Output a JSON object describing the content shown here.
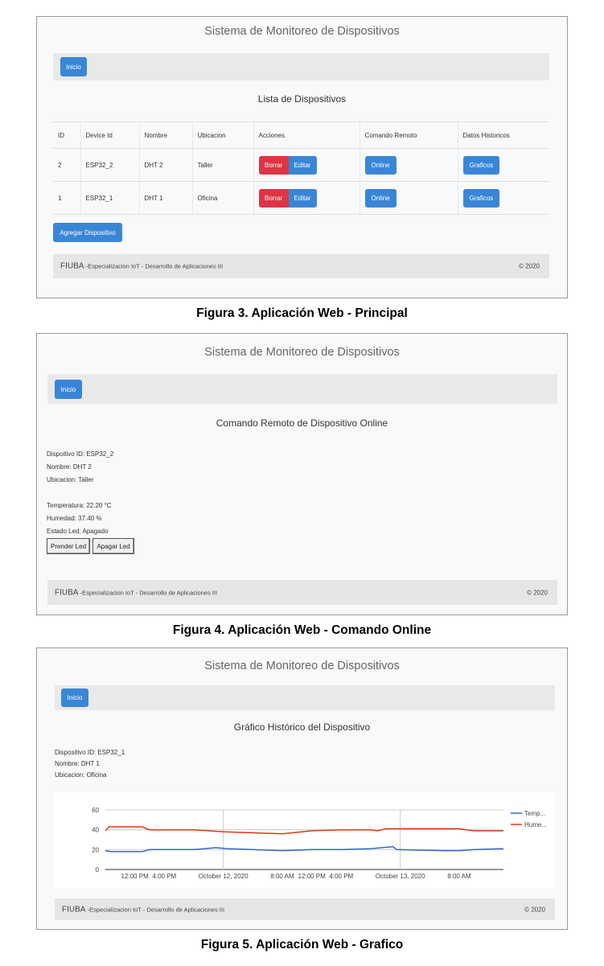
{
  "app_title": "Sistema de Monitoreo de Dispositivos",
  "nav": {
    "home_label": "Inicio"
  },
  "footer": {
    "brand": "FIUBA",
    "text": "-Especializacion IoT - Desarrollo de Aplicaciones III",
    "copyright": "© 2020"
  },
  "figure3": {
    "caption": "Figura 3. Aplicación Web - Principal",
    "subtitle": "Lista de Dispositivos",
    "columns": [
      "ID",
      "Device Id",
      "Nombre",
      "Ubicacion",
      "Acciones",
      "Comando Remoto",
      "Datos Historicos"
    ],
    "rows": [
      {
        "id": "2",
        "device_id": "ESP32_2",
        "nombre": "DHT 2",
        "ubicacion": "Taller"
      },
      {
        "id": "1",
        "device_id": "ESP32_1",
        "nombre": "DHT 1",
        "ubicacion": "Oficina"
      }
    ],
    "delete_label": "Borrar",
    "edit_label": "Editar",
    "online_label": "Online",
    "charts_label": "Graficos",
    "add_label": "Agregar Dispositivo"
  },
  "figure4": {
    "caption": "Figura 4. Aplicación Web - Comando Online",
    "subtitle": "Comando Remoto de Dispositivo Online",
    "device_line": "Dispoitivo ID: ESP32_2",
    "name_line": "Nombre: DHT 2",
    "location_line": "Ubicacion: Taller",
    "temp_line": "Temperatura: 22.20 °C",
    "humidity_line": "Humedad: 37.40 %",
    "led_line": "Estado Led: Apagado",
    "led_on_label": "Prender Led",
    "led_off_label": "Apagar Led"
  },
  "figure5": {
    "caption": "Figura 5. Aplicación Web - Grafico",
    "subtitle": "Gráfico Histórico del Dispositivo",
    "device_line": "Dispositivo ID: ESP32_1",
    "name_line": "Nombre: DHT 1",
    "location_line": "Ubicacion: Oficina"
  },
  "chart_data": {
    "type": "line",
    "title": "",
    "xlabel": "",
    "ylabel": "",
    "ylim": [
      0,
      60
    ],
    "yticks": [
      0,
      20,
      40,
      60
    ],
    "xlim": [
      "2020-10-11 08:00",
      "2020-10-13 14:00"
    ],
    "xticks": [
      {
        "t": "2020-10-11 12:00",
        "label": "12:00 PM"
      },
      {
        "t": "2020-10-11 16:00",
        "label": "4:00 PM"
      },
      {
        "t": "2020-10-12 00:00",
        "label": "October 12, 2020"
      },
      {
        "t": "2020-10-12 08:00",
        "label": "8:00 AM"
      },
      {
        "t": "2020-10-12 12:00",
        "label": "12:00 PM"
      },
      {
        "t": "2020-10-12 16:00",
        "label": "4:00 PM"
      },
      {
        "t": "2020-10-13 00:00",
        "label": "October 13, 2020"
      },
      {
        "t": "2020-10-13 08:00",
        "label": "8:00 AM"
      }
    ],
    "grid": true,
    "legend": "right",
    "series": [
      {
        "name": "Temp...",
        "color": "#3366cc",
        "points": [
          [
            "2020-10-11 08:00",
            19
          ],
          [
            "2020-10-11 08:45",
            18
          ],
          [
            "2020-10-11 13:00",
            18
          ],
          [
            "2020-10-11 14:00",
            20
          ],
          [
            "2020-10-11 20:00",
            20
          ],
          [
            "2020-10-11 23:00",
            22
          ],
          [
            "2020-10-12 00:30",
            21
          ],
          [
            "2020-10-12 04:00",
            20
          ],
          [
            "2020-10-12 08:00",
            19
          ],
          [
            "2020-10-12 12:00",
            20
          ],
          [
            "2020-10-12 16:00",
            20
          ],
          [
            "2020-10-12 20:00",
            21
          ],
          [
            "2020-10-12 23:00",
            23
          ],
          [
            "2020-10-12 23:30",
            20
          ],
          [
            "2020-10-13 06:00",
            19
          ],
          [
            "2020-10-13 08:00",
            19
          ],
          [
            "2020-10-13 10:00",
            20
          ],
          [
            "2020-10-13 14:00",
            21
          ]
        ]
      },
      {
        "name": "Hume...",
        "color": "#dc3912",
        "points": [
          [
            "2020-10-11 08:00",
            39
          ],
          [
            "2020-10-11 08:30",
            43
          ],
          [
            "2020-10-11 13:00",
            43
          ],
          [
            "2020-10-11 14:00",
            40
          ],
          [
            "2020-10-11 20:00",
            40
          ],
          [
            "2020-10-12 00:00",
            38
          ],
          [
            "2020-10-12 04:00",
            37
          ],
          [
            "2020-10-12 08:00",
            36
          ],
          [
            "2020-10-12 12:00",
            39
          ],
          [
            "2020-10-12 16:00",
            40
          ],
          [
            "2020-10-12 20:00",
            40
          ],
          [
            "2020-10-12 21:00",
            39
          ],
          [
            "2020-10-12 22:00",
            41
          ],
          [
            "2020-10-13 04:00",
            41
          ],
          [
            "2020-10-13 08:00",
            41
          ],
          [
            "2020-10-13 10:00",
            39
          ],
          [
            "2020-10-13 14:00",
            39
          ]
        ]
      }
    ]
  }
}
